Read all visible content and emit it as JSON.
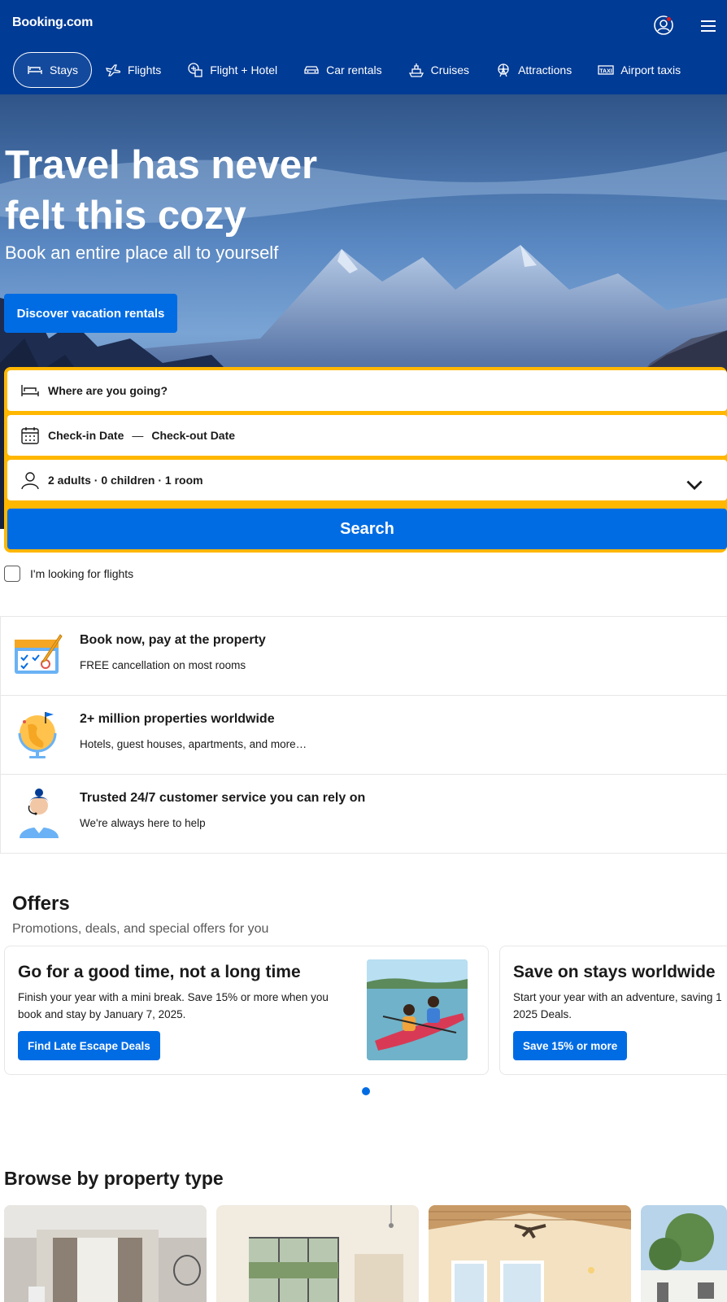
{
  "header": {
    "logo": "Booking.com",
    "nav": [
      {
        "label": "Stays",
        "icon": "bed-icon",
        "active": true
      },
      {
        "label": "Flights",
        "icon": "plane-icon"
      },
      {
        "label": "Flight + Hotel",
        "icon": "plane-hotel-icon"
      },
      {
        "label": "Car rentals",
        "icon": "car-icon"
      },
      {
        "label": "Cruises",
        "icon": "ship-icon"
      },
      {
        "label": "Attractions",
        "icon": "ferris-wheel-icon"
      },
      {
        "label": "Airport taxis",
        "icon": "taxi-icon"
      }
    ]
  },
  "hero": {
    "title": "Travel has never felt this cozy",
    "subtitle": "Book an entire place all to yourself",
    "button": "Discover vacation rentals"
  },
  "search": {
    "destination_placeholder": "Where are you going?",
    "checkin": "Check-in Date",
    "dash": "—",
    "checkout": "Check-out Date",
    "occupancy": "2 adults · 0 children · 1 room",
    "button": "Search",
    "flights_checkbox": "I'm looking for flights"
  },
  "benefits": [
    {
      "title": "Book now, pay at the property",
      "desc": "FREE cancellation on most rooms",
      "icon": "calendar-illustration"
    },
    {
      "title": "2+ million properties worldwide",
      "desc": "Hotels, guest houses, apartments, and more…",
      "icon": "globe-illustration"
    },
    {
      "title": "Trusted 24/7 customer service you can rely on",
      "desc": "We're always here to help",
      "icon": "support-agent-illustration"
    }
  ],
  "offers": {
    "title": "Offers",
    "subtitle": "Promotions, deals, and special offers for you",
    "cards": [
      {
        "title": "Go for a good time, not a long time",
        "desc_line1": "Finish your year with a mini break. Save 15% or more when you",
        "desc_line2": "book and stay by January 7, 2025.",
        "button": "Find Late Escape Deals"
      },
      {
        "title": "Save on stays worldwide",
        "desc_line1": "Start your year with an adventure, saving 1",
        "desc_line2": "2025 Deals.",
        "button": "Save 15% or more"
      }
    ]
  },
  "browse": {
    "title": "Browse by property type"
  },
  "colors": {
    "brand_blue": "#003b95",
    "action_blue": "#006ce4",
    "search_yellow": "#ffb700"
  }
}
